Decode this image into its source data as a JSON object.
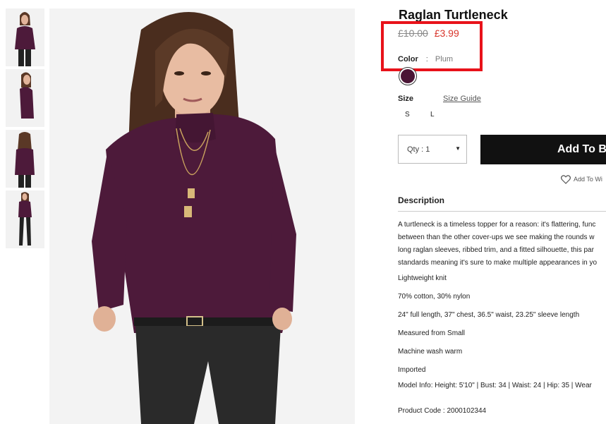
{
  "product": {
    "title": "Raglan Turtleneck",
    "price_original": "£10.00",
    "price_sale": "£3.99",
    "color_label": "Color",
    "color_sep": ":",
    "color_value": "Plum",
    "swatch_color": "#4a1535",
    "size_label": "Size",
    "size_guide": "Size Guide",
    "sizes": [
      "S",
      "L"
    ],
    "qty_label": "Qty : 1",
    "add_button": "Add To B",
    "wishlist": "Add To Wi"
  },
  "description": {
    "heading": "Description",
    "paragraph_lines": [
      "A turtleneck is a timeless topper for a reason: it's flattering, func",
      "between than the other cover-ups we see making the rounds w",
      "long raglan sleeves, ribbed trim, and a fitted silhouette, this par",
      "standards meaning it's sure to make multiple appearances in yo"
    ],
    "details": [
      "Lightweight knit",
      "70% cotton, 30% nylon",
      "24\" full length, 37\" chest, 36.5\" waist, 23.25\" sleeve length",
      "Measured from Small",
      "Machine wash warm",
      "Imported",
      "Model Info: Height: 5'10\" | Bust: 34 | Waist: 24 | Hip: 35 | Wear"
    ],
    "product_code": "Product Code : 2000102344"
  },
  "colors": {
    "sweater": "#4d1a3a",
    "sale_price": "#d8342a",
    "highlight": "#e8121a",
    "button": "#111111"
  }
}
